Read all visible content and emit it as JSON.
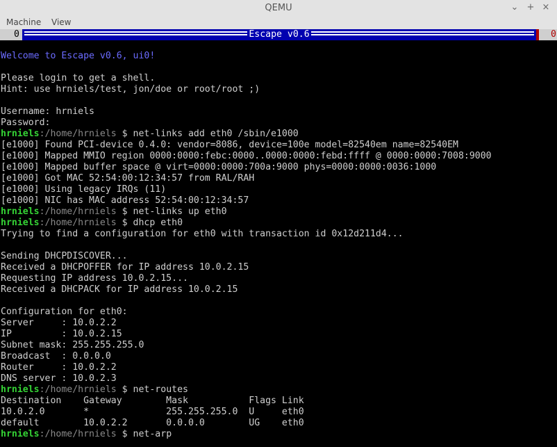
{
  "window": {
    "title": "QEMU",
    "controls": {
      "minimize": "⌄",
      "maximize": "+",
      "close": "×"
    }
  },
  "menubar": {
    "items": [
      "Machine",
      "View"
    ]
  },
  "status": {
    "left": "0",
    "title": "Escape v0.6",
    "right": "0"
  },
  "colors": {
    "blue_text": "#6b6bff",
    "prompt_user": "#35d435",
    "prompt_path": "#8a8a8a",
    "status_bar": "#0000b0",
    "status_red": "#b00000"
  },
  "terminal": {
    "lines": [
      {
        "segments": [
          {
            "text": "Welcome to Escape v0.6, ui0!",
            "color": "blue"
          }
        ]
      },
      {
        "segments": [
          {
            "text": ""
          }
        ]
      },
      {
        "segments": [
          {
            "text": "Please login to get a shell."
          }
        ]
      },
      {
        "segments": [
          {
            "text": "Hint: use hrniels/test, jon/doe or root/root ;)"
          }
        ]
      },
      {
        "segments": [
          {
            "text": ""
          }
        ]
      },
      {
        "segments": [
          {
            "text": "Username: hrniels"
          }
        ]
      },
      {
        "segments": [
          {
            "text": "Password:"
          }
        ]
      },
      {
        "segments": [
          {
            "text": "hrniels",
            "color": "user"
          },
          {
            "text": ":/home/hrniels",
            "color": "path"
          },
          {
            "text": " $ net-links add eth0 /sbin/e1000"
          }
        ]
      },
      {
        "segments": [
          {
            "text": "[e1000] Found PCI-device 0.4.0: vendor=8086, device=100e model=82540em name=82540EM"
          }
        ]
      },
      {
        "segments": [
          {
            "text": "[e1000] Mapped MMIO region 0000:0000:febc:0000..0000:0000:febd:ffff @ 0000:0000:7008:9000"
          }
        ]
      },
      {
        "segments": [
          {
            "text": "[e1000] Mapped buffer space @ virt=0000:0000:700a:9000 phys=0000:0000:0036:1000"
          }
        ]
      },
      {
        "segments": [
          {
            "text": "[e1000] Got MAC 52:54:00:12:34:57 from RAL/RAH"
          }
        ]
      },
      {
        "segments": [
          {
            "text": "[e1000] Using legacy IRQs (11)"
          }
        ]
      },
      {
        "segments": [
          {
            "text": "[e1000] NIC has MAC address 52:54:00:12:34:57"
          }
        ]
      },
      {
        "segments": [
          {
            "text": "hrniels",
            "color": "user"
          },
          {
            "text": ":/home/hrniels",
            "color": "path"
          },
          {
            "text": " $ net-links up eth0"
          }
        ]
      },
      {
        "segments": [
          {
            "text": "hrniels",
            "color": "user"
          },
          {
            "text": ":/home/hrniels",
            "color": "path"
          },
          {
            "text": " $ dhcp eth0"
          }
        ]
      },
      {
        "segments": [
          {
            "text": "Trying to find a configuration for eth0 with transaction id 0x12d211d4..."
          }
        ]
      },
      {
        "segments": [
          {
            "text": ""
          }
        ]
      },
      {
        "segments": [
          {
            "text": "Sending DHCPDISCOVER..."
          }
        ]
      },
      {
        "segments": [
          {
            "text": "Received a DHCPOFFER for IP address 10.0.2.15"
          }
        ]
      },
      {
        "segments": [
          {
            "text": "Requesting IP address 10.0.2.15..."
          }
        ]
      },
      {
        "segments": [
          {
            "text": "Received a DHCPACK for IP address 10.0.2.15"
          }
        ]
      },
      {
        "segments": [
          {
            "text": ""
          }
        ]
      },
      {
        "segments": [
          {
            "text": "Configuration for eth0:"
          }
        ]
      },
      {
        "segments": [
          {
            "text": "Server     : 10.0.2.2"
          }
        ]
      },
      {
        "segments": [
          {
            "text": "IP         : 10.0.2.15"
          }
        ]
      },
      {
        "segments": [
          {
            "text": "Subnet mask: 255.255.255.0"
          }
        ]
      },
      {
        "segments": [
          {
            "text": "Broadcast  : 0.0.0.0"
          }
        ]
      },
      {
        "segments": [
          {
            "text": "Router     : 10.0.2.2"
          }
        ]
      },
      {
        "segments": [
          {
            "text": "DNS server : 10.0.2.3"
          }
        ]
      },
      {
        "segments": [
          {
            "text": "hrniels",
            "color": "user"
          },
          {
            "text": ":/home/hrniels",
            "color": "path"
          },
          {
            "text": " $ net-routes"
          }
        ]
      },
      {
        "segments": [
          {
            "text": "Destination    Gateway        Mask           Flags Link"
          }
        ]
      },
      {
        "segments": [
          {
            "text": "10.0.2.0       *              255.255.255.0  U     eth0"
          }
        ]
      },
      {
        "segments": [
          {
            "text": "default        10.0.2.2       0.0.0.0        UG    eth0"
          }
        ]
      },
      {
        "segments": [
          {
            "text": "hrniels",
            "color": "user"
          },
          {
            "text": ":/home/hrniels",
            "color": "path"
          },
          {
            "text": " $ net-arp"
          }
        ]
      }
    ]
  }
}
